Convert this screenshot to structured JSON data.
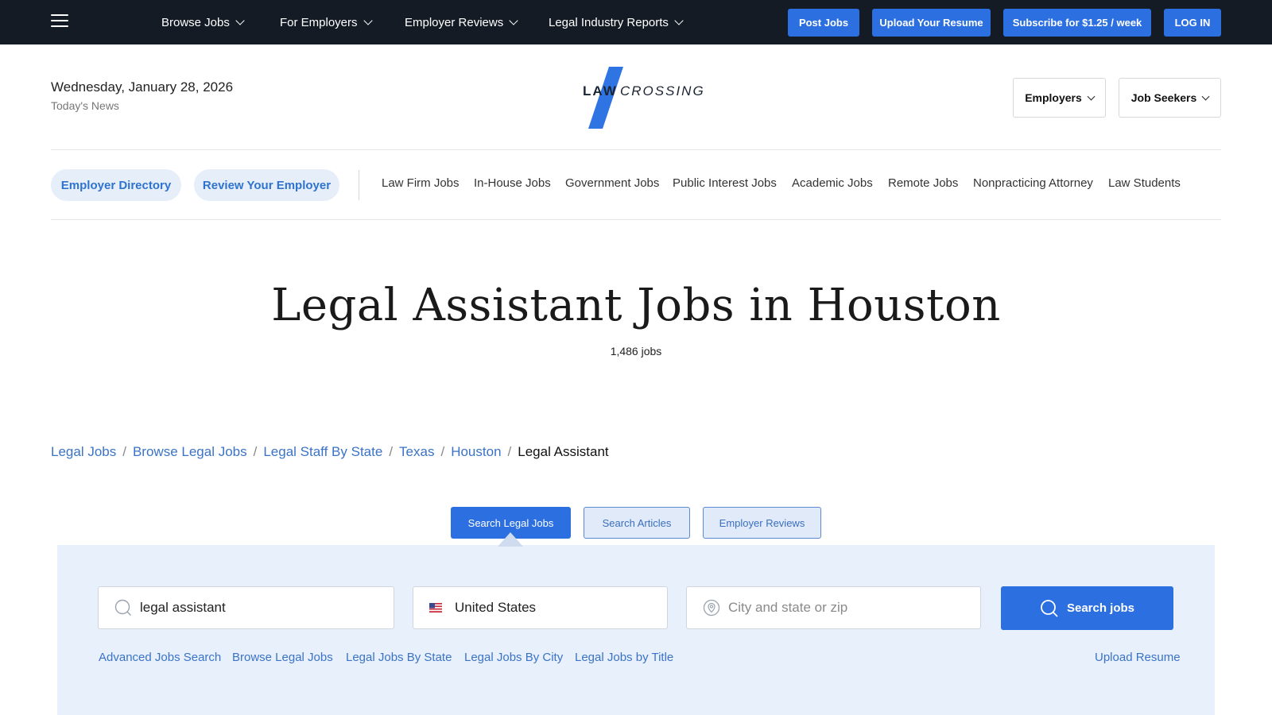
{
  "topbar": {
    "menu_icon": "hamburger-menu-icon",
    "nav": [
      {
        "label": "Browse Jobs"
      },
      {
        "label": "For Employers"
      },
      {
        "label": "Employer Reviews"
      },
      {
        "label": "Legal Industry Reports"
      }
    ],
    "buttons": {
      "post_jobs": "Post Jobs",
      "upload_resume": "Upload Your Resume",
      "subscribe": "Subscribe for $1.25 / week",
      "login": "LOG IN"
    }
  },
  "header": {
    "date": "Wednesday, January 28, 2026",
    "todays_news": "Today's News",
    "logo": {
      "word1": "LAW",
      "word2": "CROSSING"
    },
    "employers": "Employers",
    "job_seekers": "Job Seekers"
  },
  "subnav": {
    "pills": [
      "Employer Directory",
      "Review Your Employer"
    ],
    "links": [
      "Law Firm Jobs",
      "In-House Jobs",
      "Government Jobs",
      "Public Interest Jobs",
      "Academic Jobs",
      "Remote Jobs",
      "Nonpracticing Attorney",
      "Law Students"
    ]
  },
  "hero": {
    "title": "Legal Assistant Jobs in Houston",
    "count": "1,486 jobs"
  },
  "breadcrumb": {
    "links": [
      "Legal Jobs",
      "Browse Legal Jobs",
      "Legal Staff By State",
      "Texas",
      "Houston"
    ],
    "current": "Legal Assistant",
    "separator": "/"
  },
  "search": {
    "tabs": [
      "Search Legal Jobs",
      "Search Articles",
      "Employer Reviews"
    ],
    "keyword_value": "legal assistant",
    "country_value": "United States",
    "location_placeholder": "City and state or zip",
    "button": "Search jobs",
    "links": [
      "Advanced Jobs Search",
      "Browse Legal Jobs",
      "Legal Jobs By State",
      "Legal Jobs By City",
      "Legal Jobs by Title"
    ],
    "upload_resume": "Upload Resume"
  },
  "colors": {
    "topbar_bg": "#141b25",
    "accent": "#2c6fe0",
    "link": "#3b73c6",
    "panel_bg": "#e8f0fb"
  }
}
